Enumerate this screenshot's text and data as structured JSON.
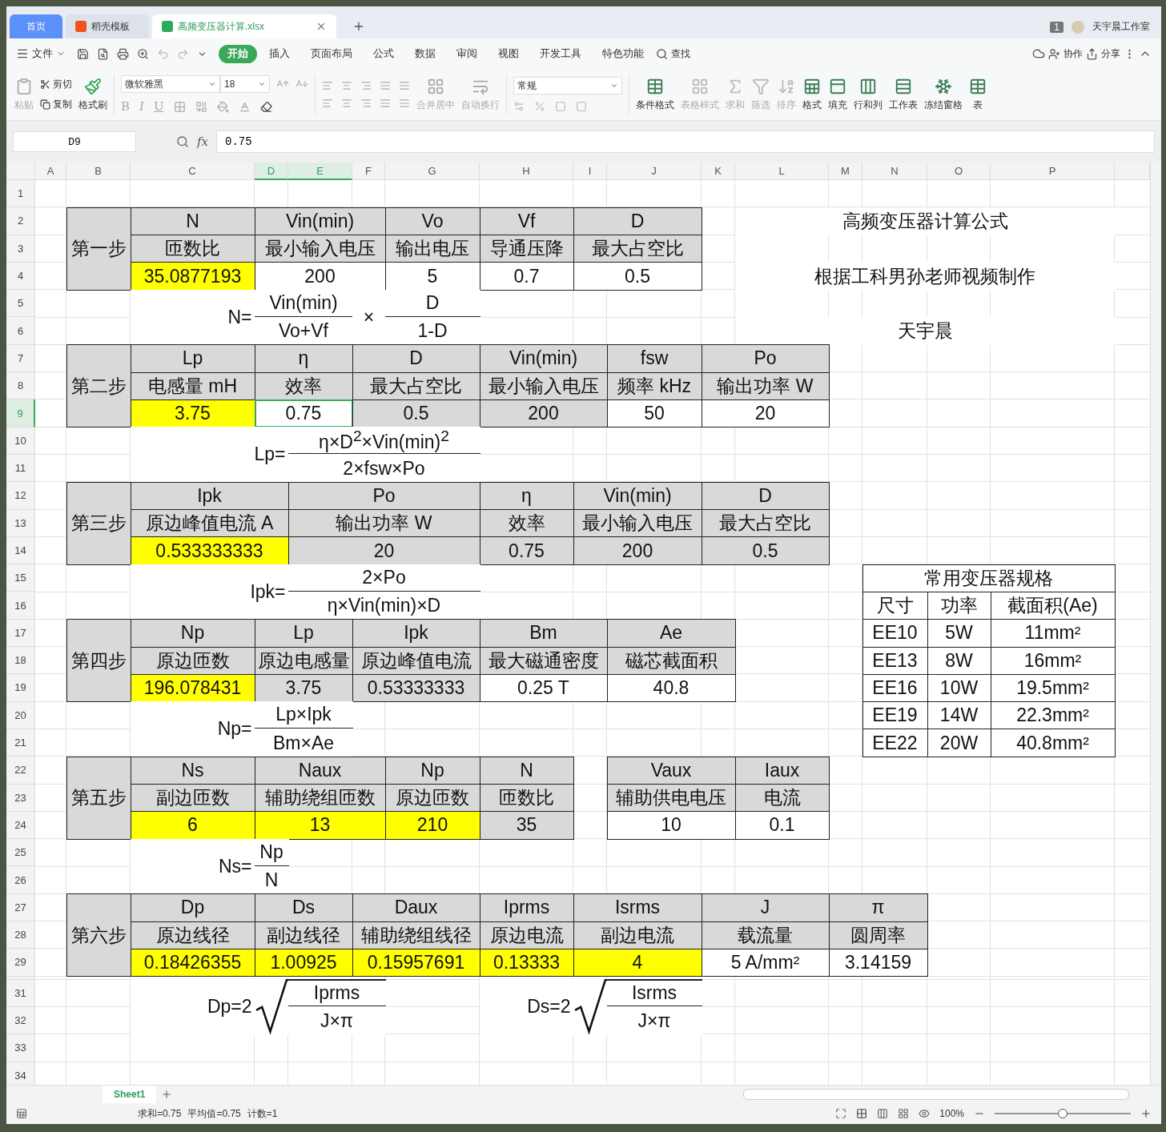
{
  "tabs": [
    {
      "label": "首页",
      "selected": false,
      "kind": "home"
    },
    {
      "label": "稻壳模板",
      "selected": false,
      "kind": "template"
    },
    {
      "label": "高频变压器计算.xlsx",
      "selected": true,
      "kind": "file"
    }
  ],
  "account": {
    "badge": "1",
    "name": "天宇晨工作室"
  },
  "menu": {
    "file": "文件",
    "tabs": [
      {
        "label": "开始",
        "selected": true
      },
      {
        "label": "插入",
        "selected": false
      },
      {
        "label": "页面布局",
        "selected": false
      },
      {
        "label": "公式",
        "selected": false
      },
      {
        "label": "数据",
        "selected": false
      },
      {
        "label": "审阅",
        "selected": false
      },
      {
        "label": "视图",
        "selected": false
      },
      {
        "label": "开发工具",
        "selected": false
      },
      {
        "label": "特色功能",
        "selected": false
      }
    ],
    "search": "查找",
    "actions": [
      "协作",
      "分享"
    ]
  },
  "ribbon": {
    "paste": {
      "label": "粘贴",
      "disabled": true
    },
    "cut": {
      "label": "剪切",
      "disabled": false
    },
    "copy": {
      "label": "复制",
      "disabled": false
    },
    "format_painter": {
      "label": "格式刷",
      "disabled": false
    },
    "font": "微软雅黑",
    "size": "18",
    "text_styles": [
      "B",
      "I",
      "U"
    ],
    "merge": {
      "label": "合并居中",
      "disabled": true
    },
    "wrap": {
      "label": "自动换行",
      "disabled": true
    },
    "number_format": "常规",
    "tools": [
      {
        "label": "条件格式",
        "disabled": false
      },
      {
        "label": "表格样式",
        "disabled": true
      },
      {
        "label": "求和",
        "disabled": true
      },
      {
        "label": "筛选",
        "disabled": true
      },
      {
        "label": "排序",
        "disabled": true
      },
      {
        "label": "格式",
        "disabled": false
      },
      {
        "label": "填充",
        "disabled": false
      },
      {
        "label": "行和列",
        "disabled": false
      },
      {
        "label": "工作表",
        "disabled": false
      },
      {
        "label": "冻结窗格",
        "disabled": false
      },
      {
        "label": "表",
        "disabled": false
      }
    ]
  },
  "formula_bar": {
    "name_box": "D9",
    "function_label": "fx",
    "value": "0.75"
  },
  "sheet": {
    "columns": [
      {
        "label": "A",
        "selected": false
      },
      {
        "label": "B",
        "selected": false
      },
      {
        "label": "C",
        "selected": false
      },
      {
        "label": "D",
        "selected": true
      },
      {
        "label": "E",
        "selected": true
      },
      {
        "label": "F",
        "selected": false
      },
      {
        "label": "G",
        "selected": false
      },
      {
        "label": "H",
        "selected": false
      },
      {
        "label": "I",
        "selected": false
      },
      {
        "label": "J",
        "selected": false
      },
      {
        "label": "K",
        "selected": false
      },
      {
        "label": "L",
        "selected": false
      },
      {
        "label": "M",
        "selected": false
      },
      {
        "label": "N",
        "selected": false
      },
      {
        "label": "O",
        "selected": false
      },
      {
        "label": "P",
        "selected": false
      }
    ],
    "rows": [
      {
        "label": "1",
        "selected": false,
        "collapsed": false
      },
      {
        "label": "2",
        "selected": false,
        "collapsed": false
      },
      {
        "label": "3",
        "selected": false,
        "collapsed": false
      },
      {
        "label": "4",
        "selected": false,
        "collapsed": false
      },
      {
        "label": "5",
        "selected": false,
        "collapsed": false
      },
      {
        "label": "6",
        "selected": false,
        "collapsed": false
      },
      {
        "label": "7",
        "selected": false,
        "collapsed": false
      },
      {
        "label": "8",
        "selected": false,
        "collapsed": false
      },
      {
        "label": "9",
        "selected": true,
        "collapsed": false
      },
      {
        "label": "10",
        "selected": false,
        "collapsed": false
      },
      {
        "label": "11",
        "selected": false,
        "collapsed": false
      },
      {
        "label": "12",
        "selected": false,
        "collapsed": false
      },
      {
        "label": "13",
        "selected": false,
        "collapsed": false
      },
      {
        "label": "14",
        "selected": false,
        "collapsed": false
      },
      {
        "label": "15",
        "selected": false,
        "collapsed": false
      },
      {
        "label": "16",
        "selected": false,
        "collapsed": false
      },
      {
        "label": "17",
        "selected": false,
        "collapsed": false
      },
      {
        "label": "18",
        "selected": false,
        "collapsed": false
      },
      {
        "label": "19",
        "selected": false,
        "collapsed": false
      },
      {
        "label": "20",
        "selected": false,
        "collapsed": false
      },
      {
        "label": "21",
        "selected": false,
        "collapsed": false
      },
      {
        "label": "22",
        "selected": false,
        "collapsed": false
      },
      {
        "label": "23",
        "selected": false,
        "collapsed": false
      },
      {
        "label": "24",
        "selected": false,
        "collapsed": false
      },
      {
        "label": "25",
        "selected": false,
        "collapsed": false
      },
      {
        "label": "26",
        "selected": false,
        "collapsed": false
      },
      {
        "label": "27",
        "selected": false,
        "collapsed": false
      },
      {
        "label": "28",
        "selected": false,
        "collapsed": false
      },
      {
        "label": "29",
        "selected": false,
        "collapsed": false
      },
      {
        "selected": false,
        "collapsed": true
      },
      {
        "label": "31",
        "selected": false,
        "collapsed": false
      },
      {
        "label": "32",
        "selected": false,
        "collapsed": false
      },
      {
        "label": "33",
        "selected": false,
        "collapsed": false
      },
      {
        "label": "34",
        "selected": false,
        "collapsed": false
      }
    ],
    "cells": [
      {
        "text": "第一步",
        "kind": "header"
      },
      {
        "text": "N",
        "kind": "header"
      },
      {
        "text": "Vin(min)",
        "kind": "header"
      },
      {
        "text": "Vo",
        "kind": "header"
      },
      {
        "text": "Vf",
        "kind": "header"
      },
      {
        "text": "D",
        "kind": "header"
      },
      {
        "text": "匝数比",
        "kind": "header"
      },
      {
        "text": "最小输入电压",
        "kind": "header"
      },
      {
        "text": "输出电压",
        "kind": "header"
      },
      {
        "text": "导通压降",
        "kind": "header"
      },
      {
        "text": "最大占空比",
        "kind": "header"
      },
      {
        "text": "35.0877193",
        "kind": "result"
      },
      {
        "text": "200",
        "kind": "value"
      },
      {
        "text": "5",
        "kind": "value"
      },
      {
        "text": "0.7",
        "kind": "value"
      },
      {
        "text": "0.5",
        "kind": "value"
      },
      {
        "text": "高频变压器计算公式",
        "kind": "plain"
      },
      {
        "text": "根据工科男孙老师视频制作",
        "kind": "plain"
      },
      {
        "text": "天宇晨",
        "kind": "plain"
      },
      {
        "text": "N=",
        "kind": "eq"
      },
      {
        "text": "Vin(min)",
        "kind": "numer"
      },
      {
        "text": "Vo+Vf",
        "kind": "denom"
      },
      {
        "text": "×",
        "kind": "op"
      },
      {
        "text": "D",
        "kind": "numer"
      },
      {
        "text": "1-D",
        "kind": "denom"
      },
      {
        "text": "第二步",
        "kind": "header"
      },
      {
        "text": "Lp",
        "kind": "header"
      },
      {
        "text": "η",
        "kind": "header"
      },
      {
        "text": "D",
        "kind": "header"
      },
      {
        "text": "Vin(min)",
        "kind": "header"
      },
      {
        "text": "fsw",
        "kind": "header"
      },
      {
        "text": "Po",
        "kind": "header"
      },
      {
        "text": "电感量 mH",
        "kind": "header"
      },
      {
        "text": "效率",
        "kind": "header"
      },
      {
        "text": "最大占空比",
        "kind": "header"
      },
      {
        "text": "最小输入电压",
        "kind": "header"
      },
      {
        "text": "频率 kHz",
        "kind": "header"
      },
      {
        "text": "输出功率 W",
        "kind": "header"
      },
      {
        "text": "3.75",
        "kind": "result"
      },
      {
        "text": "0.75",
        "kind": "value"
      },
      {
        "text": "0.5",
        "kind": "ref"
      },
      {
        "text": "200",
        "kind": "ref"
      },
      {
        "text": "50",
        "kind": "value"
      },
      {
        "text": "20",
        "kind": "value"
      },
      {
        "text": "Lp=",
        "kind": "eq"
      },
      {
        "text": "η×D$^{2}$×Vin(min)$^{2}$",
        "kind": "numer"
      },
      {
        "text": "2×fsw×Po",
        "kind": "denom"
      },
      {
        "text": "第三步",
        "kind": "header"
      },
      {
        "text": "Ipk",
        "kind": "header"
      },
      {
        "text": "Po",
        "kind": "header"
      },
      {
        "text": "η",
        "kind": "header"
      },
      {
        "text": "Vin(min)",
        "kind": "header"
      },
      {
        "text": "D",
        "kind": "header"
      },
      {
        "text": "原边峰值电流 A",
        "kind": "header"
      },
      {
        "text": "输出功率 W",
        "kind": "header"
      },
      {
        "text": "效率",
        "kind": "header"
      },
      {
        "text": "最小输入电压",
        "kind": "header"
      },
      {
        "text": "最大占空比",
        "kind": "header"
      },
      {
        "text": "0.533333333",
        "kind": "result"
      },
      {
        "text": "20",
        "kind": "ref"
      },
      {
        "text": "0.75",
        "kind": "ref"
      },
      {
        "text": "200",
        "kind": "ref"
      },
      {
        "text": "0.5",
        "kind": "ref"
      },
      {
        "text": "Ipk=",
        "kind": "eq"
      },
      {
        "text": "2×Po",
        "kind": "numer"
      },
      {
        "text": "η×Vin(min)×D",
        "kind": "denom"
      },
      {
        "text": "常用变压器规格",
        "kind": "value"
      },
      {
        "text": "尺寸",
        "kind": "value"
      },
      {
        "text": "功率",
        "kind": "value"
      },
      {
        "text": "截面积(Ae)",
        "kind": "value"
      },
      {
        "text": "EE10",
        "kind": "value"
      },
      {
        "text": "5W",
        "kind": "value"
      },
      {
        "text": "11mm²",
        "kind": "value"
      },
      {
        "text": "EE13",
        "kind": "value"
      },
      {
        "text": "8W",
        "kind": "value"
      },
      {
        "text": "16mm²",
        "kind": "value"
      },
      {
        "text": "EE16",
        "kind": "value"
      },
      {
        "text": "10W",
        "kind": "value"
      },
      {
        "text": "19.5mm²",
        "kind": "value"
      },
      {
        "text": "EE19",
        "kind": "value"
      },
      {
        "text": "14W",
        "kind": "value"
      },
      {
        "text": "22.3mm²",
        "kind": "value"
      },
      {
        "text": "EE22",
        "kind": "value"
      },
      {
        "text": "20W",
        "kind": "value"
      },
      {
        "text": "40.8mm²",
        "kind": "value"
      },
      {
        "text": "第四步",
        "kind": "header"
      },
      {
        "text": "Np",
        "kind": "header"
      },
      {
        "text": "Lp",
        "kind": "header"
      },
      {
        "text": "Ipk",
        "kind": "header"
      },
      {
        "text": "Bm",
        "kind": "header"
      },
      {
        "text": "Ae",
        "kind": "header"
      },
      {
        "text": "原边匝数",
        "kind": "header"
      },
      {
        "text": "原边电感量",
        "kind": "header"
      },
      {
        "text": "原边峰值电流",
        "kind": "header"
      },
      {
        "text": "最大磁通密度",
        "kind": "header"
      },
      {
        "text": "磁芯截面积",
        "kind": "header"
      },
      {
        "text": "196.078431",
        "kind": "result"
      },
      {
        "text": "3.75",
        "kind": "ref"
      },
      {
        "text": "0.53333333",
        "kind": "ref"
      },
      {
        "text": "0.25 T",
        "kind": "value"
      },
      {
        "text": "40.8",
        "kind": "value"
      },
      {
        "text": "Np=",
        "kind": "eq"
      },
      {
        "text": "Lp×Ipk",
        "kind": "numer"
      },
      {
        "text": "Bm×Ae",
        "kind": "denom"
      },
      {
        "text": "第五步",
        "kind": "header"
      },
      {
        "text": "Ns",
        "kind": "header"
      },
      {
        "text": "Naux",
        "kind": "header"
      },
      {
        "text": "Np",
        "kind": "header"
      },
      {
        "text": "N",
        "kind": "header"
      },
      {
        "text": "副边匝数",
        "kind": "header"
      },
      {
        "text": "辅助绕组匝数",
        "kind": "header"
      },
      {
        "text": "原边匝数",
        "kind": "header"
      },
      {
        "text": "匝数比",
        "kind": "header"
      },
      {
        "text": "6",
        "kind": "result"
      },
      {
        "text": "13",
        "kind": "result"
      },
      {
        "text": "210",
        "kind": "result"
      },
      {
        "text": "35",
        "kind": "ref"
      },
      {
        "text": "Vaux",
        "kind": "header"
      },
      {
        "text": "Iaux",
        "kind": "header"
      },
      {
        "text": "辅助供电电压",
        "kind": "header"
      },
      {
        "text": "电流",
        "kind": "header"
      },
      {
        "text": "10",
        "kind": "value"
      },
      {
        "text": "0.1",
        "kind": "value"
      },
      {
        "text": "Ns=",
        "kind": "eq"
      },
      {
        "text": "Np",
        "kind": "numer"
      },
      {
        "text": "N",
        "kind": "denom"
      },
      {
        "text": "第六步",
        "kind": "header"
      },
      {
        "text": "Dp",
        "kind": "header"
      },
      {
        "text": "Ds",
        "kind": "header"
      },
      {
        "text": "Daux",
        "kind": "header"
      },
      {
        "text": "Iprms",
        "kind": "header"
      },
      {
        "text": "Isrms",
        "kind": "header"
      },
      {
        "text": "J",
        "kind": "header"
      },
      {
        "text": "π",
        "kind": "header"
      },
      {
        "text": "原边线径",
        "kind": "header"
      },
      {
        "text": "副边线径",
        "kind": "header"
      },
      {
        "text": "辅助绕组线径",
        "kind": "header"
      },
      {
        "text": "原边电流",
        "kind": "header"
      },
      {
        "text": "副边电流",
        "kind": "header"
      },
      {
        "text": "载流量",
        "kind": "header"
      },
      {
        "text": "圆周率",
        "kind": "header"
      },
      {
        "text": "0.18426355",
        "kind": "result"
      },
      {
        "text": "1.00925",
        "kind": "result"
      },
      {
        "text": "0.15957691",
        "kind": "result"
      },
      {
        "text": "0.13333",
        "kind": "result"
      },
      {
        "text": "4",
        "kind": "result"
      },
      {
        "text": "5 A/mm²",
        "kind": "value"
      },
      {
        "text": "3.14159",
        "kind": "value"
      },
      {
        "text": "Dp=2",
        "kind": "eq"
      },
      {
        "kind": "sqrt"
      },
      {
        "text": "Iprms",
        "kind": "sqrt-numer"
      },
      {
        "text": "J×π",
        "kind": "denom"
      },
      {
        "text": "Ds=2",
        "kind": "eq"
      },
      {
        "kind": "sqrt"
      },
      {
        "text": "Isrms",
        "kind": "sqrt-numer"
      },
      {
        "text": "J×π",
        "kind": "denom"
      }
    ]
  },
  "sheet_tabs": [
    {
      "label": "Sheet1",
      "selected": true
    }
  ],
  "status": {
    "summary": [
      "求和=0.75",
      "平均值=0.75",
      "计数=1"
    ],
    "zoom": "100%",
    "zoom_level": {
      "level": 0.5
    }
  }
}
